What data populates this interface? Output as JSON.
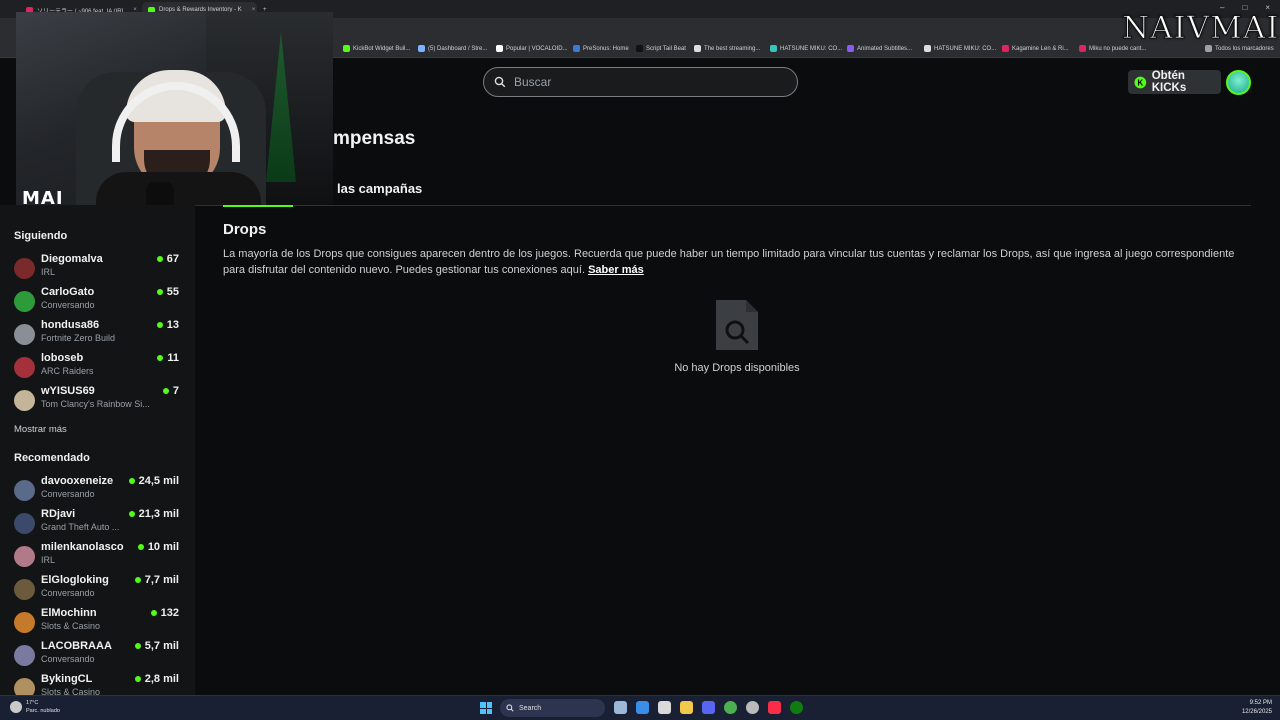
{
  "browser": {
    "tabs": [
      {
        "title": "ソリーテラー / ~906 feat. IA (IR]",
        "active": false
      },
      {
        "title": "Drops & Rewards Inventory - K",
        "active": true
      }
    ],
    "new_tab": "+",
    "bookmarks": [
      "KickBot Widget Buil...",
      "(5) Dashboard / Stre...",
      "Popular | VOCALOID...",
      "PreSonus: Home",
      "Script Tail Beat",
      "The best streaming...",
      "HATSUNE MIKU: CO...",
      "Animated Subtitles...",
      "HATSUNE MIKU: CO...",
      "Kagamine Len & Ri...",
      "Miku no puede cant..."
    ],
    "all_bookmarks": "Todos los marcadores"
  },
  "watermark": "NAIVMAI",
  "webcam_label": "MAI",
  "header": {
    "search_placeholder": "Buscar",
    "kicks_button": "Obtén KICKs"
  },
  "page": {
    "title": "mpensas",
    "tab_campaigns": "las campañas"
  },
  "sidebar": {
    "following_heading": "Siguiendo",
    "following": [
      {
        "name": "Diegomalva",
        "category": "IRL",
        "viewers": "67",
        "color": "#7a2a2a"
      },
      {
        "name": "CarloGato",
        "category": "Conversando",
        "viewers": "55",
        "color": "#2e9b3a"
      },
      {
        "name": "hondusa86",
        "category": "Fortnite Zero Build",
        "viewers": "13",
        "color": "#8a8f96"
      },
      {
        "name": "loboseb",
        "category": "ARC Raiders",
        "viewers": "11",
        "color": "#a3303a"
      },
      {
        "name": "wYISUS69",
        "category": "Tom Clancy's Rainbow Si...",
        "viewers": "7",
        "color": "#c4b49a"
      }
    ],
    "show_more": "Mostrar más",
    "recommended_heading": "Recomendado",
    "recommended": [
      {
        "name": "davooxeneize",
        "category": "Conversando",
        "viewers": "24,5 mil",
        "color": "#5a6b8a"
      },
      {
        "name": "RDjavi",
        "category": "Grand Theft Auto ...",
        "viewers": "21,3 mil",
        "color": "#3b4a6b"
      },
      {
        "name": "milenkanolasco",
        "category": "IRL",
        "viewers": "10 mil",
        "color": "#b07a8a"
      },
      {
        "name": "ElGlogloking",
        "category": "Conversando",
        "viewers": "7,7 mil",
        "color": "#6b5a3b"
      },
      {
        "name": "ElMochinn",
        "category": "Slots & Casino",
        "viewers": "132",
        "color": "#c47a2a"
      },
      {
        "name": "LACOBRAAA",
        "category": "Conversando",
        "viewers": "5,7 mil",
        "color": "#7a7aa0"
      },
      {
        "name": "BykingCL",
        "category": "Slots & Casino",
        "viewers": "2,8 mil",
        "color": "#b09060"
      }
    ]
  },
  "drops": {
    "heading": "Drops",
    "description": "La mayoría de los Drops que consigues aparecen dentro de los juegos. Recuerda que puede haber un tiempo limitado para vincular tus cuentas y reclamar los Drops, así que ingresa al juego correspondiente para disfrutar del contenido nuevo. Puedes gestionar tus conexiones aquí.",
    "learn_more": "Saber más",
    "empty_state": "No hay Drops disponibles"
  },
  "taskbar": {
    "temperature": "17°C",
    "weather": "Parc. nublado",
    "search": "Search",
    "time": "9:52 PM",
    "date": "12/26/2025"
  },
  "colors": {
    "accent": "#53fc18",
    "background": "#0b0c0d",
    "sidebar": "#121416"
  }
}
